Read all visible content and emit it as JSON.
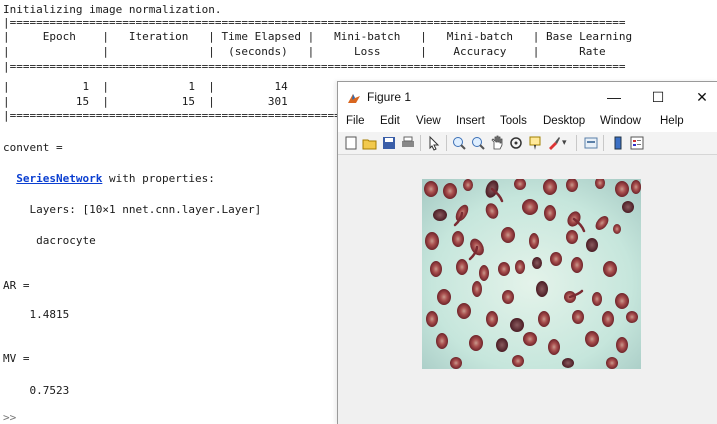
{
  "console": {
    "lines": [
      "Initializing image normalization.",
      "|=============================================================================================",
      "|     Epoch    |   Iteration   | Time Elapsed |   Mini-batch   |   Mini-batch   | Base Learning",
      "|              |               |  (seconds)   |      Loss      |    Accuracy    |      Rate",
      "|=============================================================================================",
      "|           1  |            1  |         14",
      "|          15  |           15  |        301",
      "|============================================================",
      "",
      "convent =",
      "",
      "  ",
      "",
      "    Layers: [10×1 nnet.cnn.layer.Layer]",
      "",
      "     dacrocyte",
      "",
      "",
      "AR =",
      "",
      "    1.4815",
      "",
      "",
      "MV =",
      "",
      "    0.7523",
      "",
      ">>"
    ],
    "series_link": "SeriesNetwork",
    "series_suffix": " with properties:"
  },
  "figure": {
    "title": "Figure 1",
    "minimize": "—",
    "maximize": "☐",
    "close": "✕",
    "menu": [
      "File",
      "Edit",
      "View",
      "Insert",
      "Tools",
      "Desktop",
      "Window",
      "Help"
    ],
    "toolbar_icons": [
      "new-figure-icon",
      "open-file-icon",
      "save-icon",
      "print-icon",
      "pointer-icon",
      "zoom-in-icon",
      "zoom-out-icon",
      "pan-icon",
      "rotate-3d-icon",
      "data-cursor-icon",
      "brush-icon",
      "link-icon",
      "colorbar-icon",
      "legend-icon"
    ],
    "image": "blood-smear-image"
  },
  "colors": {
    "link": "#0b3fd1",
    "cell": "#8e2f33",
    "cell_center": "#c99a8d",
    "smear_bg": "#cfe9dd"
  }
}
